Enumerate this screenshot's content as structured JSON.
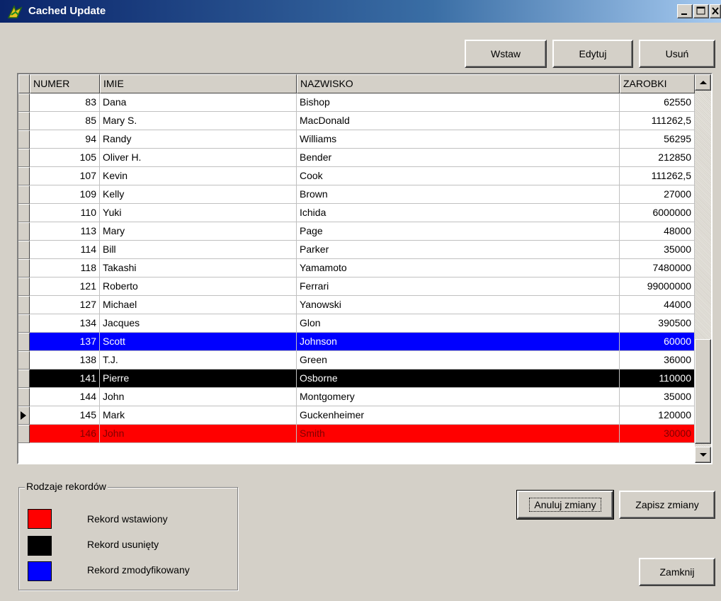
{
  "window": {
    "title": "Cached Update"
  },
  "toolbar": {
    "insert_label": "Wstaw",
    "edit_label": "Edytuj",
    "delete_label": "Usuń"
  },
  "grid": {
    "columns": [
      "NUMER",
      "IMIE",
      "NAZWISKO",
      "ZAROBKI"
    ],
    "rows": [
      {
        "numer": "83",
        "imie": "Dana",
        "nazwisko": "Bishop",
        "zarobki": "62550",
        "state": ""
      },
      {
        "numer": "85",
        "imie": "Mary S.",
        "nazwisko": "MacDonald",
        "zarobki": "111262,5",
        "state": ""
      },
      {
        "numer": "94",
        "imie": "Randy",
        "nazwisko": "Williams",
        "zarobki": "56295",
        "state": ""
      },
      {
        "numer": "105",
        "imie": "Oliver H.",
        "nazwisko": "Bender",
        "zarobki": "212850",
        "state": ""
      },
      {
        "numer": "107",
        "imie": "Kevin",
        "nazwisko": "Cook",
        "zarobki": "111262,5",
        "state": ""
      },
      {
        "numer": "109",
        "imie": "Kelly",
        "nazwisko": "Brown",
        "zarobki": "27000",
        "state": ""
      },
      {
        "numer": "110",
        "imie": "Yuki",
        "nazwisko": "Ichida",
        "zarobki": "6000000",
        "state": ""
      },
      {
        "numer": "113",
        "imie": "Mary",
        "nazwisko": "Page",
        "zarobki": "48000",
        "state": ""
      },
      {
        "numer": "114",
        "imie": "Bill",
        "nazwisko": "Parker",
        "zarobki": "35000",
        "state": ""
      },
      {
        "numer": "118",
        "imie": "Takashi",
        "nazwisko": "Yamamoto",
        "zarobki": "7480000",
        "state": ""
      },
      {
        "numer": "121",
        "imie": "Roberto",
        "nazwisko": "Ferrari",
        "zarobki": "99000000",
        "state": ""
      },
      {
        "numer": "127",
        "imie": "Michael",
        "nazwisko": "Yanowski",
        "zarobki": "44000",
        "state": ""
      },
      {
        "numer": "134",
        "imie": "Jacques",
        "nazwisko": "Glon",
        "zarobki": "390500",
        "state": ""
      },
      {
        "numer": "137",
        "imie": "Scott",
        "nazwisko": "Johnson",
        "zarobki": "60000",
        "state": "modified"
      },
      {
        "numer": "138",
        "imie": "T.J.",
        "nazwisko": "Green",
        "zarobki": "36000",
        "state": ""
      },
      {
        "numer": "141",
        "imie": "Pierre",
        "nazwisko": "Osborne",
        "zarobki": "110000",
        "state": "deleted"
      },
      {
        "numer": "144",
        "imie": "John",
        "nazwisko": "Montgomery",
        "zarobki": "35000",
        "state": ""
      },
      {
        "numer": "145",
        "imie": "Mark",
        "nazwisko": "Guckenheimer",
        "zarobki": "120000",
        "state": "current"
      },
      {
        "numer": "146",
        "imie": "John",
        "nazwisko": "Smith",
        "zarobki": "30000",
        "state": "inserted"
      }
    ]
  },
  "legend": {
    "title": "Rodzaje rekordów",
    "items": [
      {
        "label": "Rekord wstawiony",
        "color": "#ff0000"
      },
      {
        "label": "Rekord usunięty",
        "color": "#000000"
      },
      {
        "label": "Rekord zmodyfikowany",
        "color": "#0000ff"
      }
    ]
  },
  "actions": {
    "cancel_changes": "Anuluj zmiany",
    "save_changes": "Zapisz zmiany",
    "close": "Zamknij"
  },
  "icons": {
    "app": "app-logo-icon",
    "minimize": "minimize-icon",
    "maximize": "maximize-icon",
    "close": "close-icon",
    "scroll_up": "scroll-up-arrow-icon",
    "scroll_down": "scroll-down-arrow-icon",
    "row_pointer": "row-pointer-icon"
  }
}
